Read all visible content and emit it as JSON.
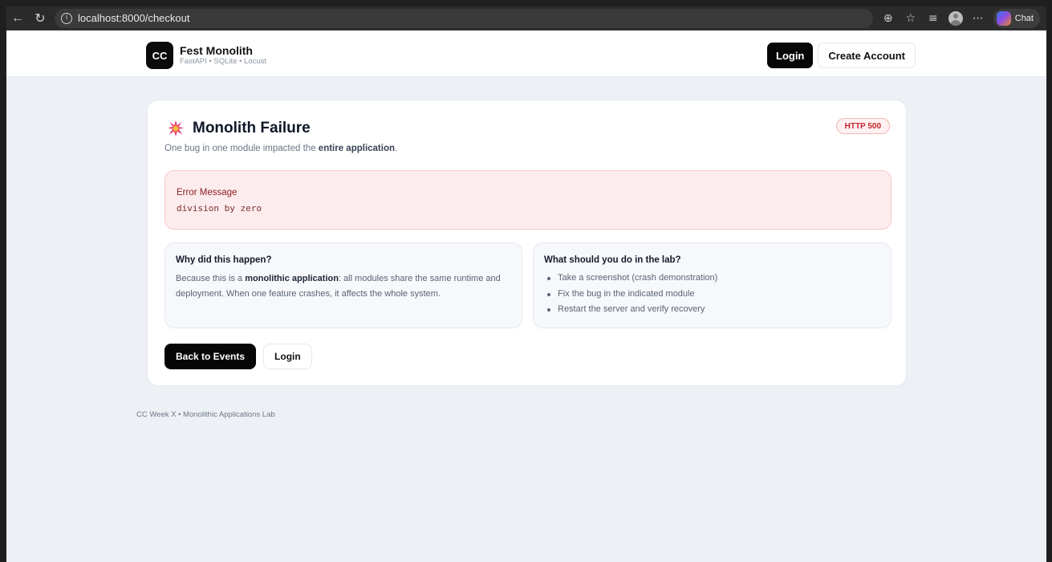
{
  "browser": {
    "url": "localhost:8000/checkout",
    "chat_label": "Chat"
  },
  "header": {
    "logo_text": "CC",
    "brand_name": "Fest Monolith",
    "brand_sub": "FastAPI • SQLite • Locust",
    "login_label": "Login",
    "create_account_label": "Create Account"
  },
  "card": {
    "title": "Monolith Failure",
    "badge": "HTTP 500",
    "subtitle_pre": "One bug in one module impacted the ",
    "subtitle_bold": "entire application",
    "subtitle_post": ".",
    "error": {
      "label": "Error Message",
      "message": "division by zero"
    },
    "why": {
      "title": "Why did this happen?",
      "text_pre": "Because this is a ",
      "text_bold": "monolithic application",
      "text_post": ": all modules share the same runtime and deployment. When one feature crashes, it affects the whole system."
    },
    "todo": {
      "title": "What should you do in the lab?",
      "items": [
        "Take a screenshot (crash demonstration)",
        "Fix the bug in the indicated module",
        "Restart the server and verify recovery"
      ]
    },
    "back_label": "Back to Events",
    "login_label": "Login"
  },
  "footer": {
    "text": "CC Week X • Monolithic Applications Lab"
  },
  "colors": {
    "accent_dark": "#070707",
    "error_bg": "#fdeced",
    "error_text": "#8b1f23",
    "badge_red": "#c0262d",
    "page_bg": "#edf1f6"
  },
  "icons": {
    "back": "back-arrow-icon",
    "reload": "reload-icon",
    "info": "info-icon",
    "burst": "explosion-icon"
  }
}
